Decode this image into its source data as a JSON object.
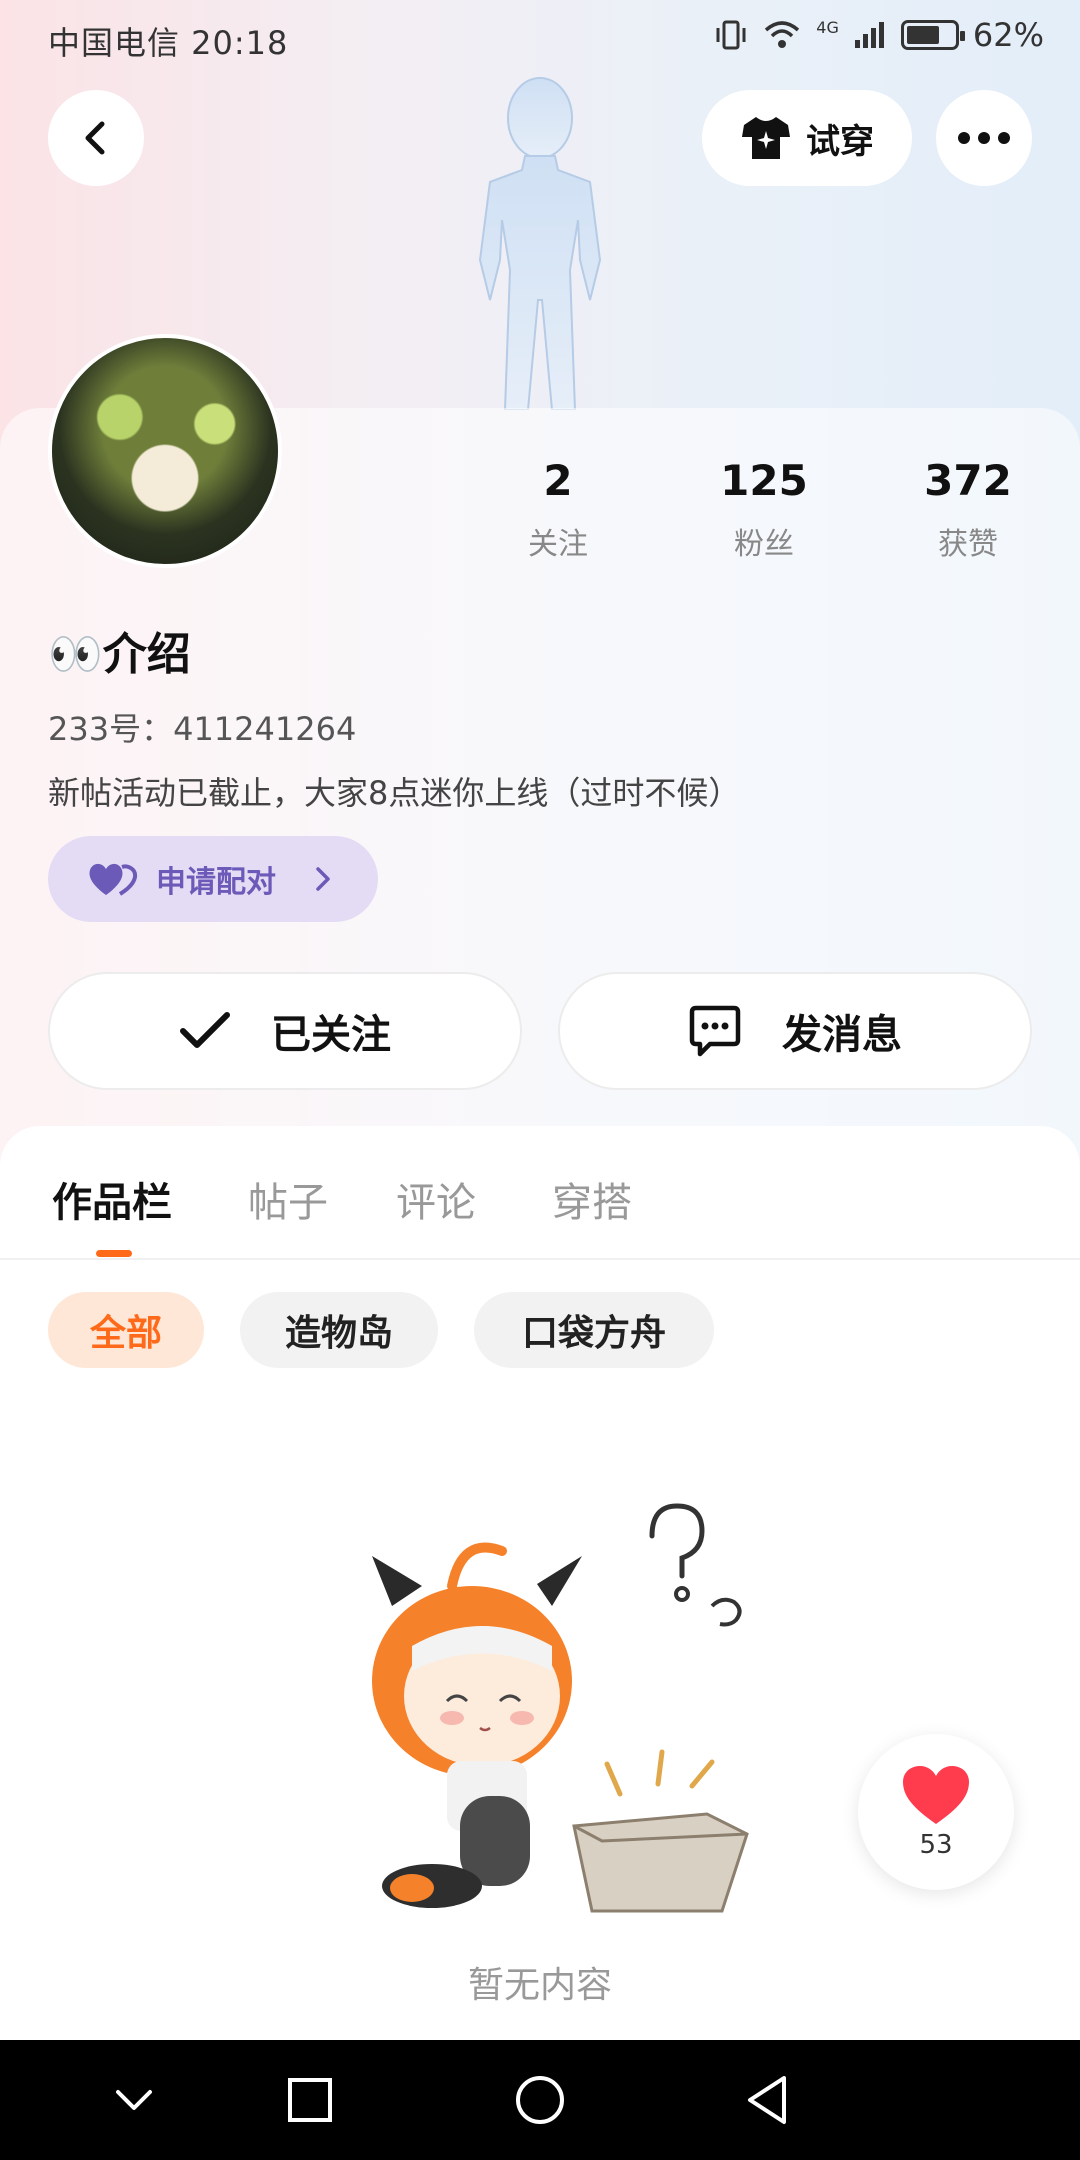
{
  "status_bar": {
    "carrier_time": "中国电信 20:18",
    "network": "4G",
    "battery": "62%"
  },
  "topbar": {
    "back_icon": "chevron-left-icon",
    "try_on_label": "试穿",
    "more_icon": "more-dots-icon"
  },
  "profile": {
    "nickname": "👀介绍",
    "uid": "233号：411241264",
    "bio": "新帖活动已截止，大家8点迷你上线（过时不候）",
    "stats": [
      {
        "value": "2",
        "label": "关注"
      },
      {
        "value": "125",
        "label": "粉丝"
      },
      {
        "value": "372",
        "label": "获赞"
      }
    ],
    "pair_label": "申请配对",
    "followed_label": "已关注",
    "message_label": "发消息"
  },
  "tabs": [
    {
      "label": "作品栏",
      "active": true
    },
    {
      "label": "帖子",
      "active": false
    },
    {
      "label": "评论",
      "active": false
    },
    {
      "label": "穿搭",
      "active": false
    }
  ],
  "filters": [
    {
      "label": "全部",
      "active": true
    },
    {
      "label": "造物岛",
      "active": false
    },
    {
      "label": "口袋方舟",
      "active": false
    }
  ],
  "empty_text": "暂无内容",
  "like_float": {
    "count": "53"
  },
  "colors": {
    "accent": "#ff6a1a",
    "pair_purple": "#6c5ab8",
    "heart_red": "#ff3b4e"
  }
}
